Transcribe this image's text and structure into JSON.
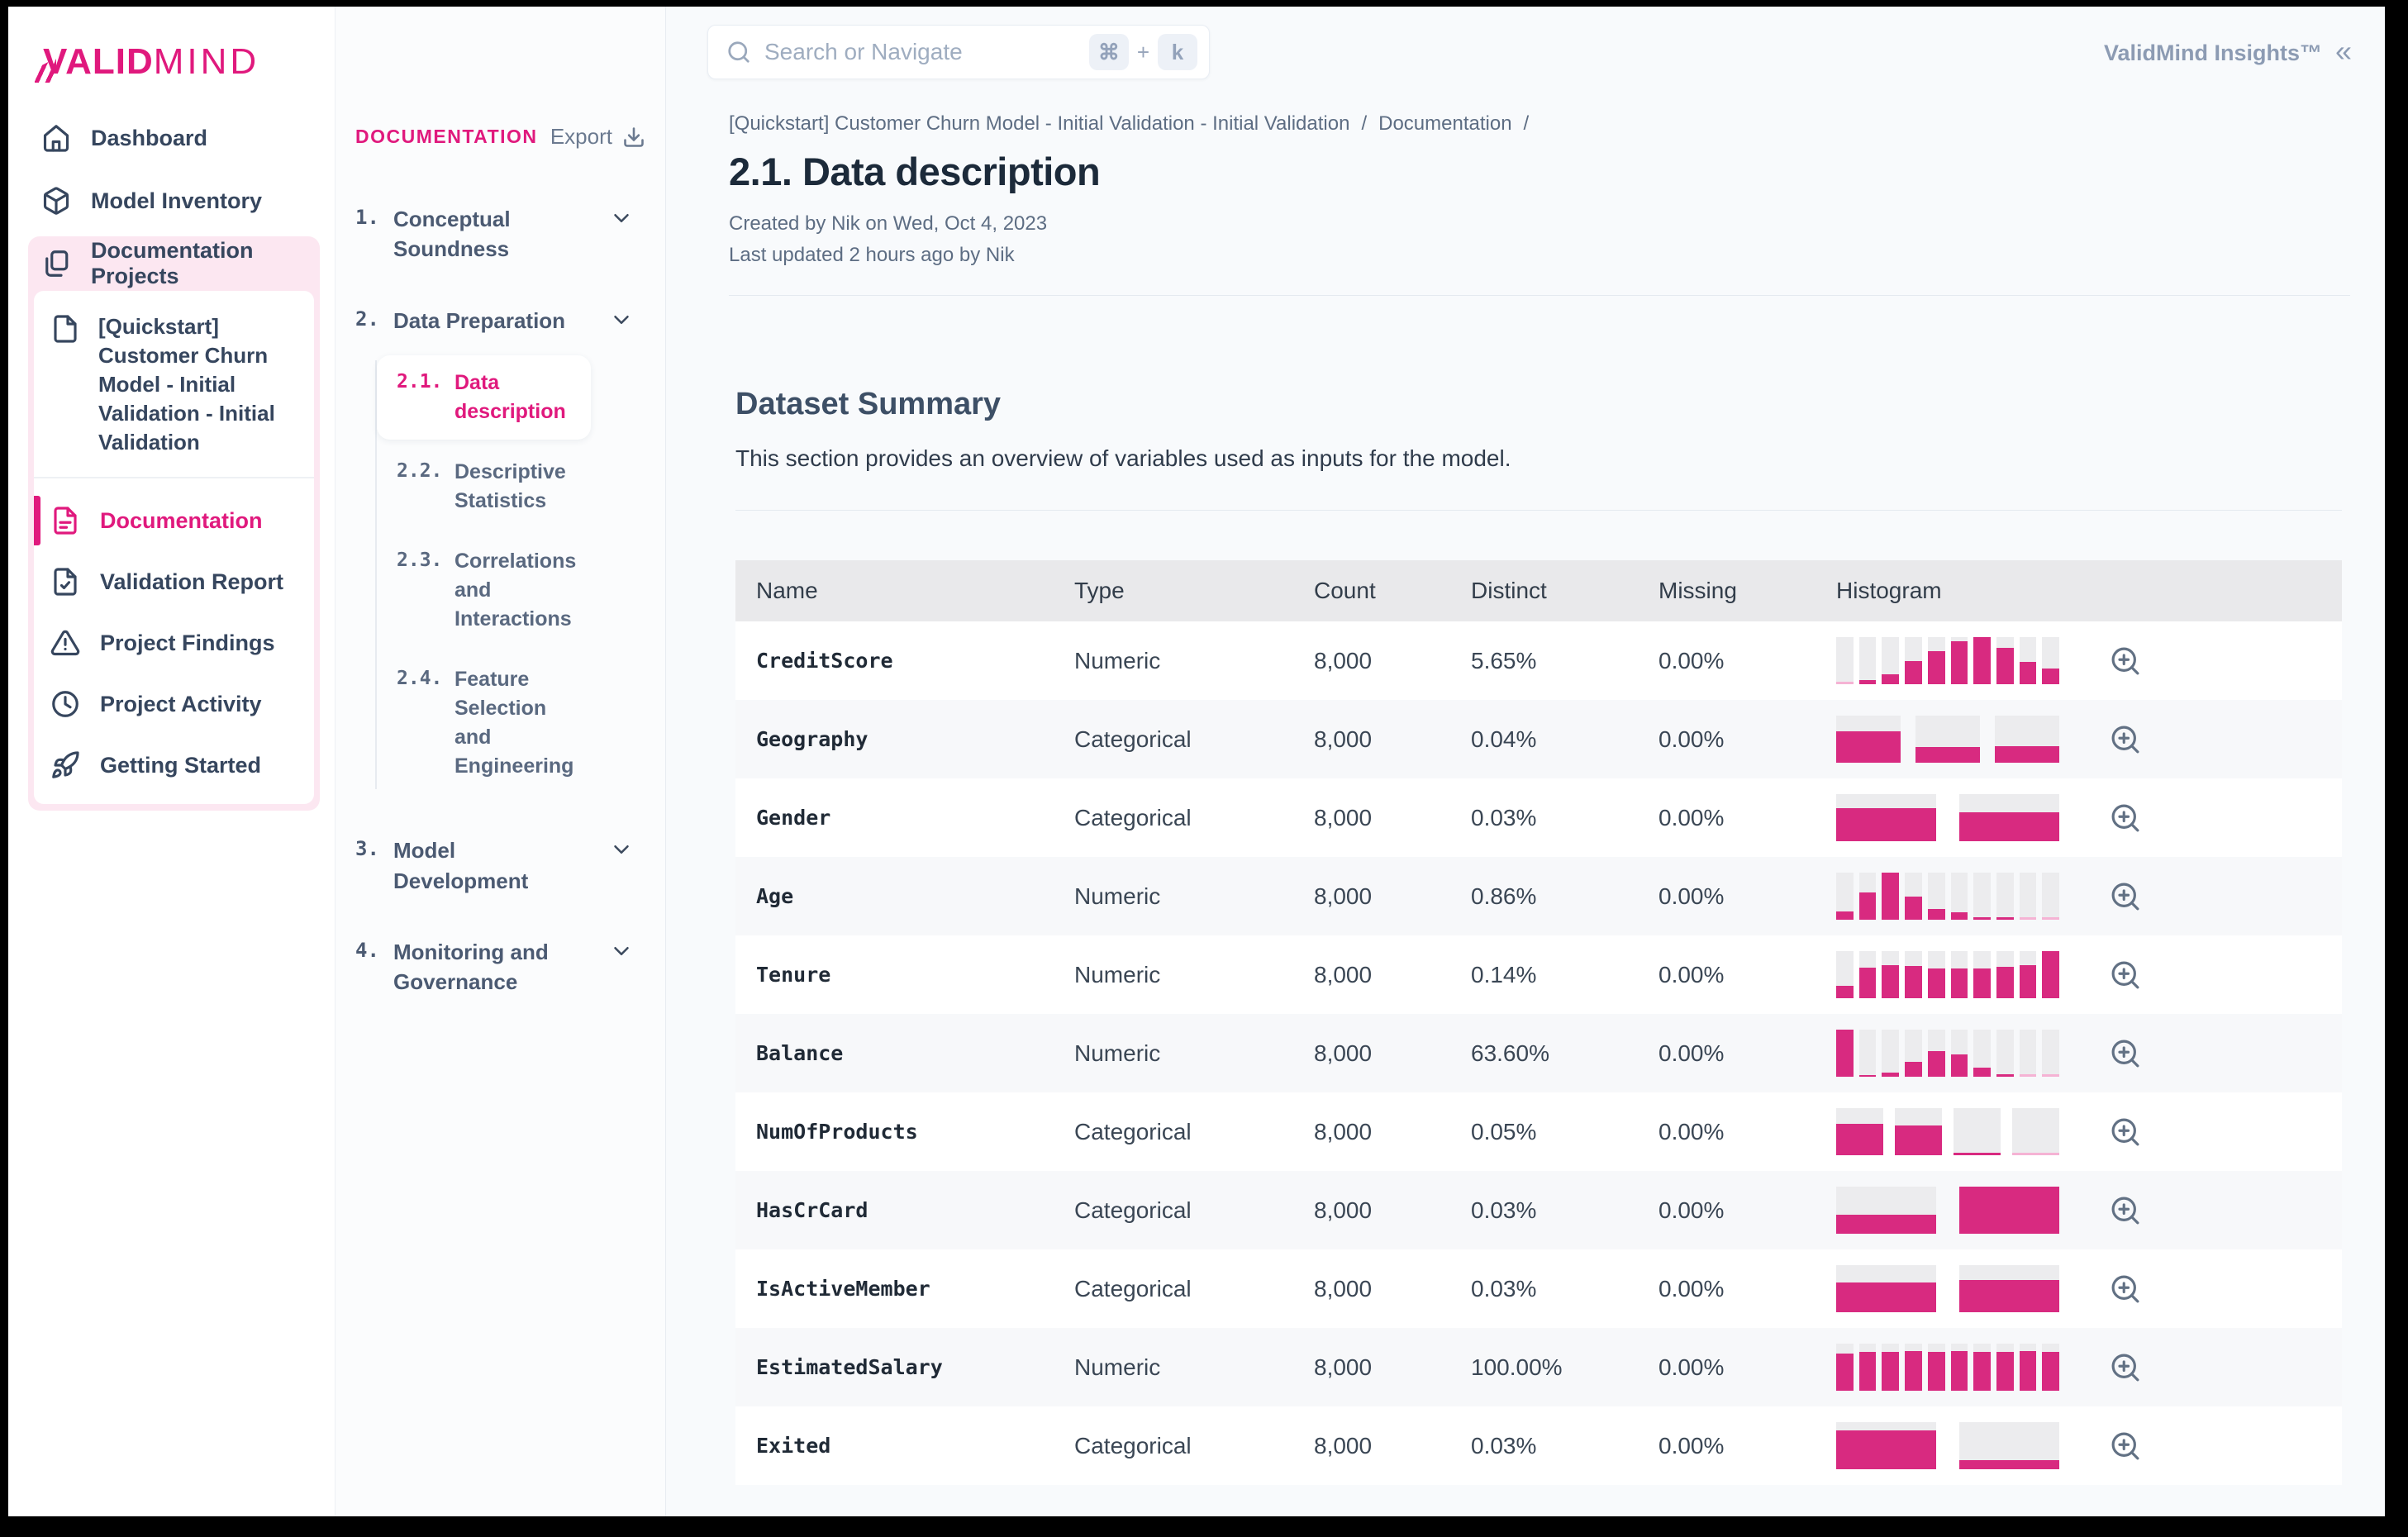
{
  "brand": {
    "logo_bold": "VALID",
    "logo_light": "MIND"
  },
  "colors": {
    "brand_pink": "#e0197d",
    "bar_pink": "#d82a80",
    "bar_faint_pink": "#f5b3d4",
    "bar_track": "#ececee",
    "highlight_bg": "#fce7f1",
    "content_bg": "#f8fafc",
    "header_row_bg": "#e9e9eb"
  },
  "sidebar": {
    "items": [
      {
        "label": "Dashboard",
        "icon": "home",
        "active": false
      },
      {
        "label": "Model Inventory",
        "icon": "model-inventory",
        "active": false
      },
      {
        "label": "Documentation Projects",
        "icon": "documentation-projects",
        "active": true
      }
    ],
    "project": {
      "icon": "file",
      "name": "[Quickstart] Customer Churn Model - Initial Validation - Initial Validation",
      "items": [
        {
          "label": "Documentation",
          "icon": "file-text",
          "active": true
        },
        {
          "label": "Validation Report",
          "icon": "file-check",
          "active": false
        },
        {
          "label": "Project Findings",
          "icon": "alert-triangle",
          "active": false
        },
        {
          "label": "Project Activity",
          "icon": "clock",
          "active": false
        },
        {
          "label": "Getting Started",
          "icon": "rocket",
          "active": false
        }
      ]
    }
  },
  "doc_nav": {
    "heading": "DOCUMENTATION",
    "export_label": "Export",
    "export_icon": "download",
    "sections": [
      {
        "num": "1.",
        "label": "Conceptual Soundness",
        "chevron": true,
        "children": []
      },
      {
        "num": "2.",
        "label": "Data Preparation",
        "chevron": true,
        "children": [
          {
            "num": "2.1.",
            "label": "Data description",
            "active": true
          },
          {
            "num": "2.2.",
            "label": "Descriptive Statistics",
            "active": false
          },
          {
            "num": "2.3.",
            "label": "Correlations and Interactions",
            "active": false
          },
          {
            "num": "2.4.",
            "label": "Feature Selection and Engineering",
            "active": false
          }
        ]
      },
      {
        "num": "3.",
        "label": "Model Development",
        "chevron": true,
        "children": []
      },
      {
        "num": "4.",
        "label": "Monitoring and Governance",
        "chevron": true,
        "children": []
      }
    ]
  },
  "topbar": {
    "search_placeholder": "Search or Navigate",
    "shortcut": {
      "key1": "⌘",
      "plus": "+",
      "key2": "k"
    },
    "insights_label": "ValidMind Insights™",
    "collapse_glyph": "«"
  },
  "page": {
    "breadcrumb": {
      "project": "[Quickstart] Customer Churn Model - Initial Validation - Initial Validation",
      "sep1": "/",
      "section": "Documentation",
      "sep2": "/"
    },
    "title": "2.1. Data description",
    "created": "Created by Nik on Wed, Oct 4, 2023",
    "updated": "Last updated 2 hours ago by Nik"
  },
  "section": {
    "title": "Dataset Summary",
    "description": "This section provides an overview of variables used as inputs for the model."
  },
  "table": {
    "headers": [
      "Name",
      "Type",
      "Count",
      "Distinct",
      "Missing",
      "Histogram"
    ],
    "zoom_icon": "zoom-in",
    "rows": [
      {
        "name": "CreditScore",
        "type": "Numeric",
        "count": "8,000",
        "distinct": "5.65%",
        "missing": "0.00%",
        "hist": [
          0.02,
          0.08,
          0.21,
          0.5,
          0.7,
          0.92,
          1.0,
          0.78,
          0.48,
          0.34
        ]
      },
      {
        "name": "Geography",
        "type": "Categorical",
        "count": "8,000",
        "distinct": "0.04%",
        "missing": "0.00%",
        "hist": [
          0.67,
          0.34,
          0.35
        ]
      },
      {
        "name": "Gender",
        "type": "Categorical",
        "count": "8,000",
        "distinct": "0.03%",
        "missing": "0.00%",
        "hist": [
          0.7,
          0.61
        ]
      },
      {
        "name": "Age",
        "type": "Numeric",
        "count": "8,000",
        "distinct": "0.86%",
        "missing": "0.00%",
        "hist": [
          0.17,
          0.58,
          1.0,
          0.5,
          0.22,
          0.15,
          0.05,
          0.05,
          0.02,
          0.01
        ]
      },
      {
        "name": "Tenure",
        "type": "Numeric",
        "count": "8,000",
        "distinct": "0.14%",
        "missing": "0.00%",
        "hist": [
          0.26,
          0.65,
          0.71,
          0.68,
          0.63,
          0.64,
          0.63,
          0.67,
          0.71,
          1.0
        ]
      },
      {
        "name": "Balance",
        "type": "Numeric",
        "count": "8,000",
        "distinct": "63.60%",
        "missing": "0.00%",
        "hist": [
          1.0,
          0.03,
          0.08,
          0.31,
          0.54,
          0.48,
          0.19,
          0.05,
          0.02,
          0.01
        ]
      },
      {
        "name": "NumOfProducts",
        "type": "Categorical",
        "count": "8,000",
        "distinct": "0.05%",
        "missing": "0.00%",
        "hist": [
          0.66,
          0.63,
          0.05,
          0.02
        ]
      },
      {
        "name": "HasCrCard",
        "type": "Categorical",
        "count": "8,000",
        "distinct": "0.03%",
        "missing": "0.00%",
        "hist": [
          0.41,
          1.0
        ]
      },
      {
        "name": "IsActiveMember",
        "type": "Categorical",
        "count": "8,000",
        "distinct": "0.03%",
        "missing": "0.00%",
        "hist": [
          0.64,
          0.69
        ]
      },
      {
        "name": "EstimatedSalary",
        "type": "Numeric",
        "count": "8,000",
        "distinct": "100.00%",
        "missing": "0.00%",
        "hist": [
          0.79,
          0.82,
          0.82,
          0.85,
          0.82,
          0.84,
          0.82,
          0.82,
          0.85,
          0.82
        ]
      },
      {
        "name": "Exited",
        "type": "Categorical",
        "count": "8,000",
        "distinct": "0.03%",
        "missing": "0.00%",
        "hist": [
          0.83,
          0.19
        ]
      }
    ]
  }
}
